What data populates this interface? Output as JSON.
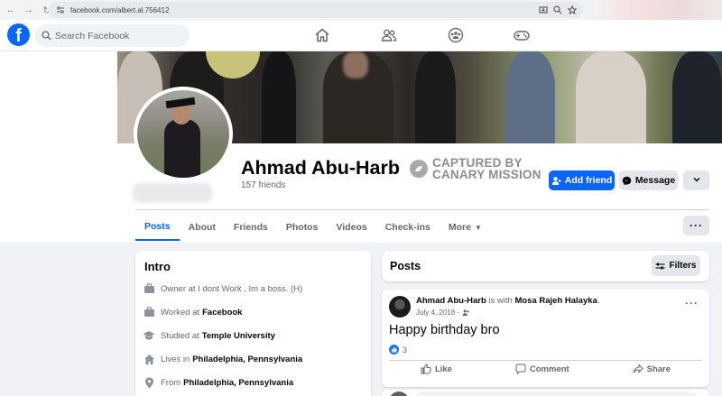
{
  "browser": {
    "url": "facebook.com/albert.al.756412"
  },
  "header": {
    "logo_letter": "f",
    "search_placeholder": "Search Facebook",
    "nav_icons": [
      "home-icon",
      "friends-icon",
      "groups-icon",
      "gaming-icon"
    ]
  },
  "profile": {
    "name": "Ahmad Abu-Harb",
    "friends": "157 friends",
    "watermark_line1": "CAPTURED BY",
    "watermark_line2": "CANARY MISSION",
    "add_friend_label": "Add friend",
    "message_label": "Message"
  },
  "tabs": [
    {
      "label": "Posts",
      "active": true
    },
    {
      "label": "About"
    },
    {
      "label": "Friends"
    },
    {
      "label": "Photos"
    },
    {
      "label": "Videos"
    },
    {
      "label": "Check-ins"
    },
    {
      "label": "More"
    }
  ],
  "intro": {
    "title": "Intro",
    "items": [
      {
        "icon": "briefcase-icon",
        "text": "Owner at I dont Work , Im a boss. (H)"
      },
      {
        "icon": "briefcase-icon",
        "pre": "Worked at",
        "bold": "Facebook"
      },
      {
        "icon": "graduation-cap-icon",
        "pre": "Studied at",
        "bold": "Temple University"
      },
      {
        "icon": "home-icon",
        "pre": "Lives in",
        "bold": "Philadelphia, Pennsylvania"
      },
      {
        "icon": "location-pin-icon",
        "pre": "From",
        "bold": "Philadelphia, Pennsylvania"
      }
    ]
  },
  "posts": {
    "title": "Posts",
    "filters_label": "Filters",
    "post": {
      "author": "Ahmad Abu-Harb",
      "with_text": "is with",
      "tagged": "Mosa Rajeh Halayka",
      "date": "July 4, 2018 ·",
      "text": "Happy birthday bro",
      "like_count": "3",
      "actions": [
        "Like",
        "Comment",
        "Share"
      ]
    }
  },
  "colors": {
    "accent": "#0866ff",
    "background": "#f0f2f5"
  }
}
